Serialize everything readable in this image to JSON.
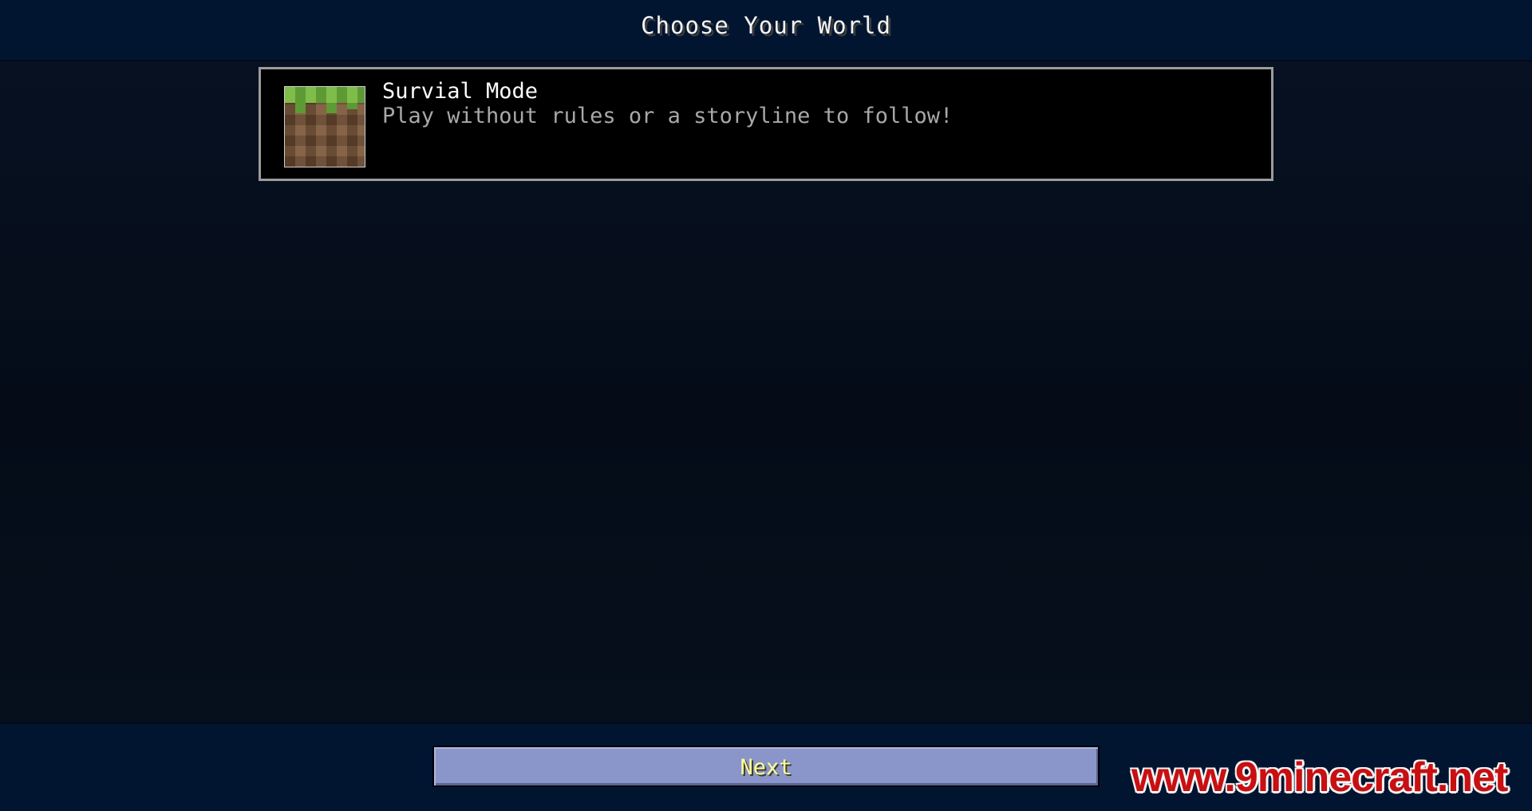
{
  "header": {
    "title": "Choose Your World"
  },
  "worlds": [
    {
      "name": "Survial Mode",
      "description": "Play without rules or a storyline to follow!",
      "icon": "grass-block-icon"
    }
  ],
  "footer": {
    "next_label": "Next"
  },
  "watermark": "www.9minecraft.net",
  "colors": {
    "bar": "#021530",
    "background": "#06101f",
    "entry_border": "#9c9c9c",
    "button": "#8a95c9",
    "button_text": "#ffffa0",
    "watermark": "#c80f12"
  }
}
